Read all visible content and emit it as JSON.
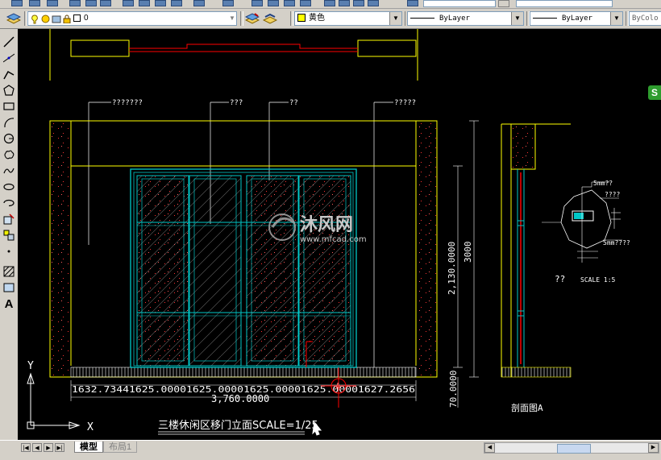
{
  "toolbar": {
    "layer_combo_value": "0",
    "color_combo_value": "黄色",
    "linetype_combo_value": "ByLayer",
    "lineweight_combo_value": "ByLayer",
    "plotstyle_combo_value": "ByColo",
    "first_combo_value": "——",
    "second_combo_value": "ByLayer"
  },
  "left_toolbar": {
    "text_tool_label": "A"
  },
  "drawing": {
    "leader_labels": [
      "???????",
      "???",
      "??",
      "?????"
    ],
    "dim_bottom_segments": "1632.73441625.00001625.00001625.00001625.00001627.2656",
    "dim_bottom_total": "3,760.0000",
    "dim_right_height": "2,130.0000",
    "dim_right_total": "3000",
    "dim_right_base": "70.0000",
    "section_note_1": "5mm??",
    "section_note_2": "????",
    "section_note_3": "5mm????",
    "detail_label": "??",
    "detail_scale": "SCALE 1:5",
    "section_label": "剖面图A",
    "section_marker": "A",
    "title": "三楼休闲区移门立面SCALE=1/25",
    "ucs_x": "X",
    "ucs_y": "Y",
    "watermark_main": "沐风网",
    "watermark_url": "www.mfcad.com"
  },
  "tabs": {
    "model": "模型",
    "layout1": "布局1"
  },
  "side_badge": "S",
  "colors": {
    "canvas_bg": "#000000",
    "yellow_line": "#ffff00",
    "cyan_line": "#00c8c8",
    "red_line": "#ff0000",
    "white_line": "#ffffff"
  }
}
